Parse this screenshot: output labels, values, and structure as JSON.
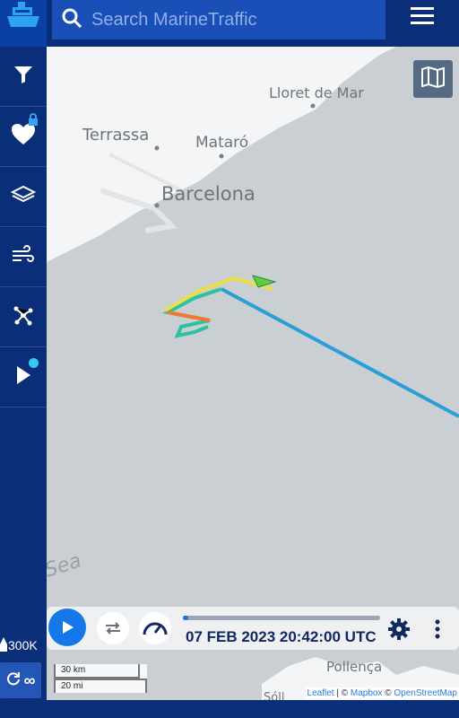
{
  "search": {
    "placeholder": "Search MarineTraffic"
  },
  "sidebar": {
    "items": [
      {
        "icon": "filter-icon"
      },
      {
        "icon": "heart-icon",
        "locked": true
      },
      {
        "icon": "layers-icon"
      },
      {
        "icon": "wind-icon"
      },
      {
        "icon": "network-icon"
      },
      {
        "icon": "play-icon",
        "badge": true
      }
    ],
    "counter": "300K",
    "loop_symbol": "∞"
  },
  "map": {
    "places": {
      "lloret": "Lloret de Mar",
      "terrassa": "Terrassa",
      "mataro": "Mataró",
      "barcelona": "Barcelona",
      "sea": "Sea",
      "pollenca": "Pollença",
      "soller": "Sóll"
    },
    "scale_km": "30 km",
    "scale_mi": "20 mi",
    "attribution": {
      "leaflet": "Leaflet",
      "sep": " | © ",
      "mapbox": "Mapbox",
      "sep2": " © ",
      "osm": "OpenStreetMap"
    }
  },
  "playback": {
    "timestamp": "07 FEB 2023 20:42:00 UTC",
    "progress": 0.02
  },
  "colors": {
    "accent": "#1678e8",
    "nav": "#0b2e79",
    "track": "#2a9fd6"
  }
}
